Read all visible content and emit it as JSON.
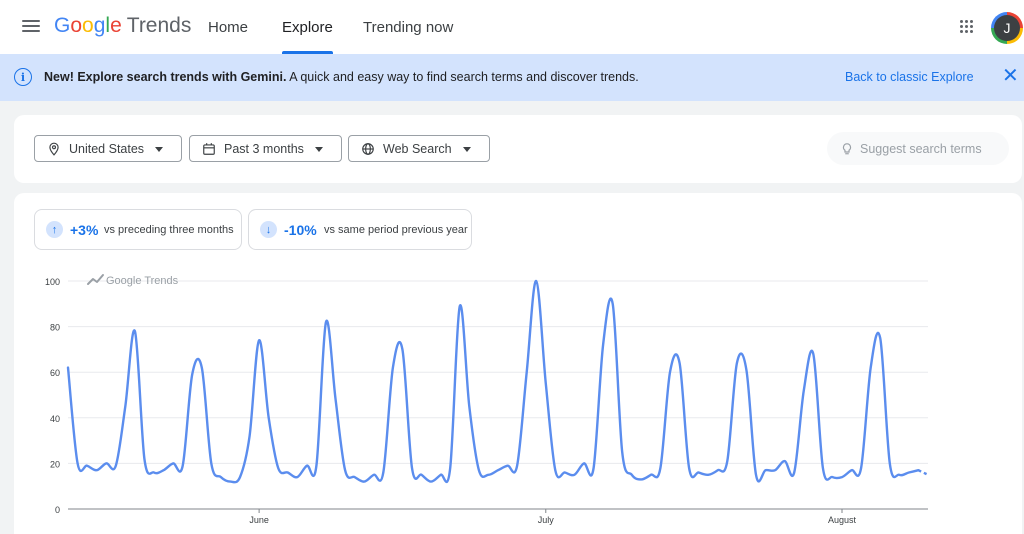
{
  "header": {
    "logo_google": "Google",
    "logo_trends": "Trends",
    "nav": [
      "Home",
      "Explore",
      "Trending now"
    ],
    "active_nav": "Explore",
    "avatar_initial": "J"
  },
  "banner": {
    "bold": "New! Explore search trends with Gemini.",
    "text": " A quick and easy way to find search terms and discover trends.",
    "link": "Back to classic Explore",
    "info_glyph": "i",
    "close_glyph": "✕"
  },
  "filters": {
    "location": "United States",
    "time_range": "Past 3 months",
    "property": "Web Search",
    "suggest": "Suggest search terms"
  },
  "stats": [
    {
      "arrow": "↑",
      "value": "+3%",
      "label": "vs preceding three months"
    },
    {
      "arrow": "↓",
      "value": "-10%",
      "label": "vs same period previous year"
    }
  ],
  "colors": {
    "line": "#5b8dee",
    "accent": "#1a73e8",
    "banner": "#d3e3fd"
  },
  "chart_data": {
    "type": "line",
    "watermark": "Google Trends",
    "ylim": [
      0,
      100
    ],
    "yticks": [
      0,
      20,
      40,
      60,
      80,
      100
    ],
    "xticks": [
      {
        "label": "June",
        "index": 20
      },
      {
        "label": "July",
        "index": 50
      },
      {
        "label": "August",
        "index": 81
      }
    ],
    "grid": true,
    "partial_last_point": true,
    "values": [
      62,
      20,
      19,
      17,
      20,
      19,
      45,
      78,
      22,
      16,
      17,
      20,
      19,
      59,
      62,
      20,
      14,
      12,
      14,
      32,
      74,
      40,
      18,
      16,
      14,
      19,
      19,
      82,
      48,
      17,
      14,
      12,
      15,
      16,
      62,
      70,
      18,
      15,
      12,
      15,
      18,
      89,
      45,
      17,
      15,
      17,
      19,
      19,
      60,
      100,
      55,
      17,
      16,
      15,
      20,
      18,
      72,
      90,
      25,
      15,
      13,
      15,
      18,
      60,
      64,
      18,
      16,
      15,
      17,
      21,
      64,
      61,
      15,
      17,
      17,
      21,
      16,
      52,
      68,
      18,
      14,
      14,
      17,
      18,
      62,
      75,
      20,
      15,
      16,
      17,
      15
    ]
  }
}
